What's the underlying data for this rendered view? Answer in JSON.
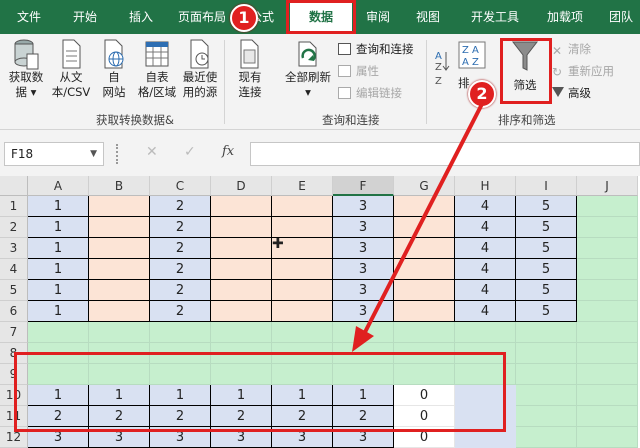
{
  "tabs": [
    "文件",
    "开始",
    "插入",
    "页面布局",
    "公式",
    "数据",
    "审阅",
    "视图",
    "开发工具",
    "加载项",
    "团队"
  ],
  "ribbon": {
    "get_data": {
      "label1": "获取数",
      "label2": "据 ▾"
    },
    "from_csv": {
      "label1": "从文",
      "label2": "本/CSV"
    },
    "from_web": {
      "label1": "自",
      "label2": "网站"
    },
    "from_table": {
      "label1": "自表",
      "label2": "格/区域"
    },
    "recent": {
      "label1": "最近使",
      "label2": "用的源"
    },
    "existing": {
      "label1": "现有",
      "label2": "连接"
    },
    "group_get": "获取转换数据&",
    "refresh_all": {
      "label1": "全部刷新",
      "label2": "▾"
    },
    "queries": "查询和连接",
    "properties": "属性",
    "edit_links": "编辑链接",
    "group_queries": "查询和连接",
    "sort_label": "排",
    "filter_label": "筛选",
    "clear": "清除",
    "reapply": "重新应用",
    "advanced": "高级",
    "group_sort": "排序和筛选"
  },
  "formula_bar": {
    "name_box": "F18",
    "fx": "fx"
  },
  "columns": [
    "A",
    "B",
    "C",
    "D",
    "E",
    "F",
    "G",
    "H",
    "I",
    "J"
  ],
  "rows": [
    "1",
    "2",
    "3",
    "4",
    "5",
    "6",
    "7",
    "8",
    "9",
    "10",
    "11",
    "12"
  ],
  "cells_top": {
    "A": [
      "1",
      "1",
      "1",
      "1",
      "1",
      "1"
    ],
    "C": [
      "2",
      "2",
      "2",
      "2",
      "2",
      "2"
    ],
    "F": [
      "3",
      "3",
      "3",
      "3",
      "3",
      "3"
    ],
    "H": [
      "4",
      "4",
      "4",
      "4",
      "4",
      "4"
    ],
    "I": [
      "5",
      "5",
      "5",
      "5",
      "5",
      "5"
    ]
  },
  "cells_bottom": [
    [
      "1",
      "1",
      "1",
      "1",
      "1",
      "1",
      "0"
    ],
    [
      "2",
      "2",
      "2",
      "2",
      "2",
      "2",
      "0"
    ],
    [
      "3",
      "3",
      "3",
      "3",
      "3",
      "3",
      "0"
    ]
  ],
  "annotations": {
    "step1": "1",
    "step2": "2"
  },
  "colors": {
    "accent": "#217346",
    "highlight": "#e02020",
    "blue_cell": "#d9e1f2",
    "pink_cell": "#fce4d6",
    "green_cell": "#c6efce"
  }
}
